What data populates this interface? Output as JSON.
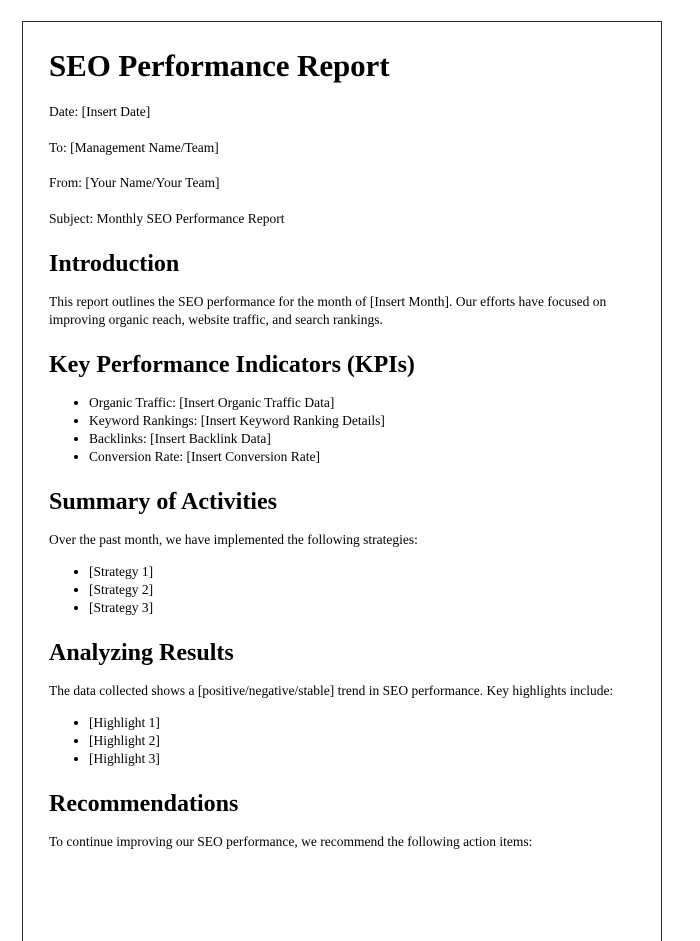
{
  "document": {
    "title": "SEO Performance Report",
    "meta": [
      "Date: [Insert Date]",
      "To: [Management Name/Team]",
      "From: [Your Name/Your Team]",
      "Subject: Monthly SEO Performance Report"
    ],
    "sections": {
      "introduction": {
        "heading": "Introduction",
        "paragraph": "This report outlines the SEO performance for the month of [Insert Month]. Our efforts have focused on improving organic reach, website traffic, and search rankings."
      },
      "kpis": {
        "heading": "Key Performance Indicators (KPIs)",
        "items": [
          "Organic Traffic: [Insert Organic Traffic Data]",
          "Keyword Rankings: [Insert Keyword Ranking Details]",
          "Backlinks: [Insert Backlink Data]",
          "Conversion Rate: [Insert Conversion Rate]"
        ]
      },
      "summary": {
        "heading": "Summary of Activities",
        "paragraph": "Over the past month, we have implemented the following strategies:",
        "items": [
          "[Strategy 1]",
          "[Strategy 2]",
          "[Strategy 3]"
        ]
      },
      "analyzing": {
        "heading": "Analyzing Results",
        "paragraph": "The data collected shows a [positive/negative/stable] trend in SEO performance. Key highlights include:",
        "items": [
          "[Highlight 1]",
          "[Highlight 2]",
          "[Highlight 3]"
        ]
      },
      "recommendations": {
        "heading": "Recommendations",
        "paragraph": "To continue improving our SEO performance, we recommend the following action items:"
      }
    }
  },
  "colors": {
    "page_border": "#2b2b2b",
    "text": "#000000",
    "background": "#ffffff"
  }
}
